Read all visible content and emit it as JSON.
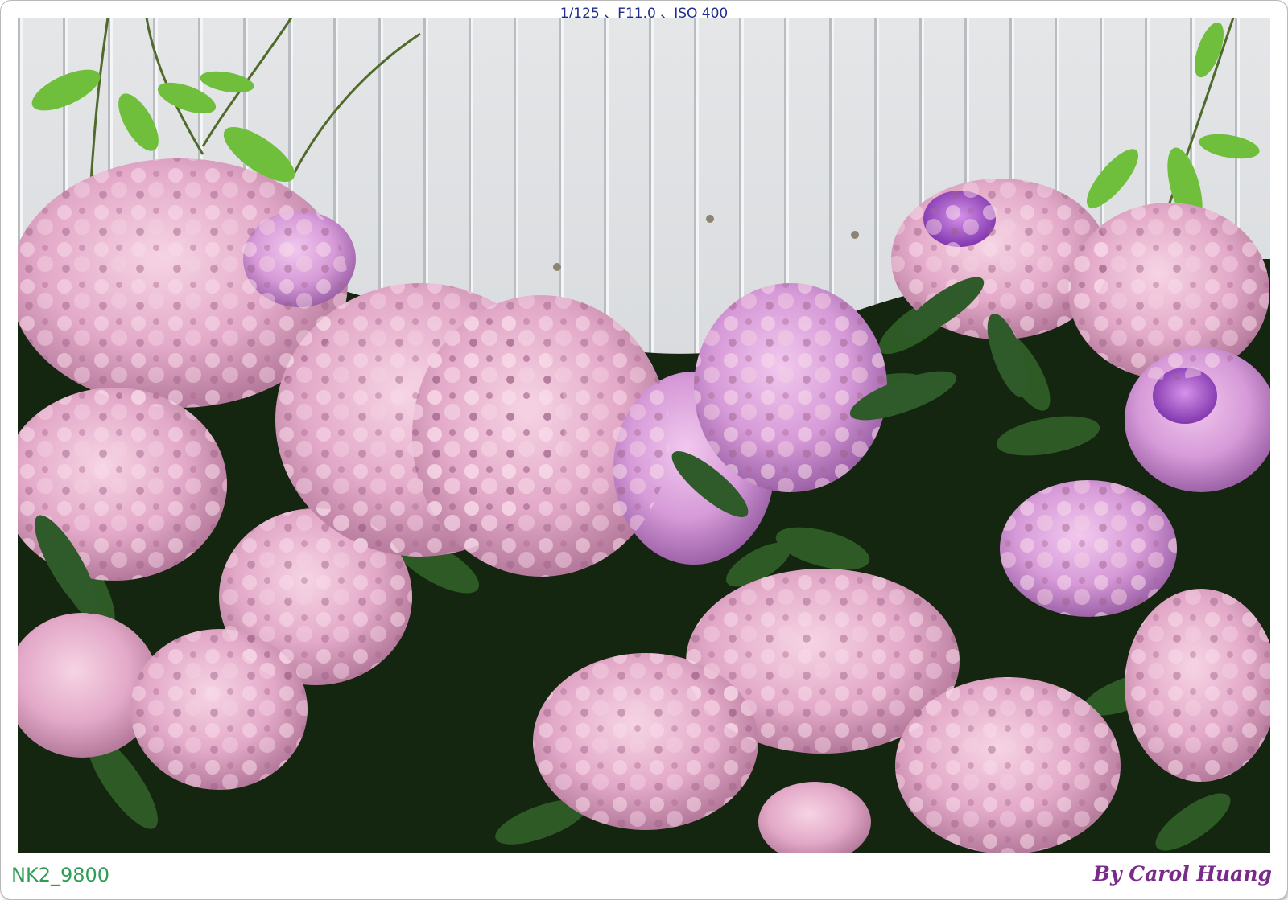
{
  "exif": "1/125 、F11.0 、ISO 400",
  "filename": "NK2_9800",
  "signature": "By Carol Huang",
  "colors": {
    "exif": "#1f2d8f",
    "filename": "#2e9e54",
    "signature": "#7a2a8a",
    "wall": "#dadde0",
    "flower_pink": "#e8b6cf",
    "flower_purple": "#b26ad0",
    "leaf": "#2f5a2a"
  }
}
